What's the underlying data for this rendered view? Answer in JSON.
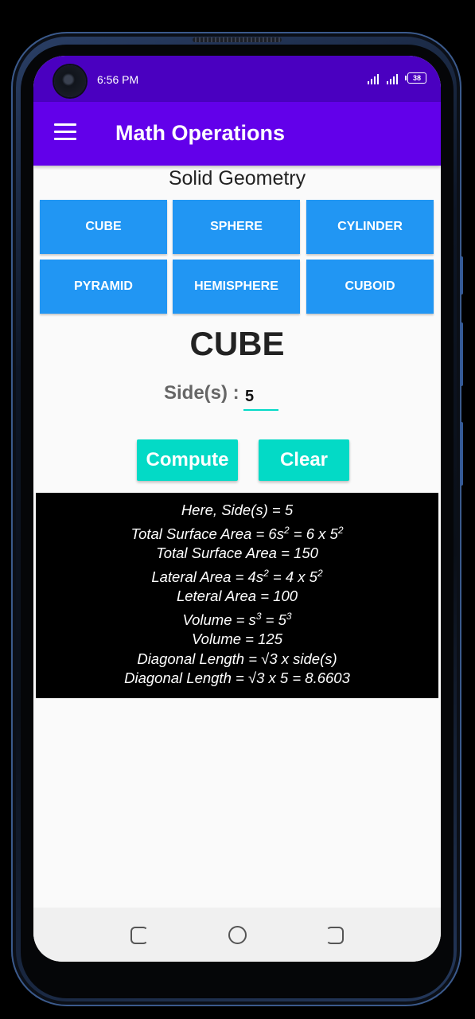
{
  "status_bar": {
    "time": "6:56 PM",
    "battery": "38"
  },
  "app_bar": {
    "title": "Math Operations"
  },
  "section_title": "Solid Geometry",
  "shapes": [
    {
      "label": "CUBE"
    },
    {
      "label": "SPHERE"
    },
    {
      "label": "CYLINDER"
    },
    {
      "label": "PYRAMID"
    },
    {
      "label": "HEMISPHERE"
    },
    {
      "label": "CUBOID"
    }
  ],
  "selected_shape": "CUBE",
  "input": {
    "label": "Side(s) :",
    "value": "5"
  },
  "buttons": {
    "compute": "Compute",
    "clear": "Clear"
  },
  "results": [
    {
      "text": "Here, Side(s) = 5"
    },
    {
      "parts": [
        "Total Surface Area = 6s",
        "2",
        " = 6 x 5",
        "2"
      ]
    },
    {
      "text": "Total Surface Area = 150"
    },
    {
      "parts": [
        "Lateral Area = 4s",
        "2",
        " = 4 x 5",
        "2"
      ]
    },
    {
      "text": "Leteral Area = 100"
    },
    {
      "parts": [
        "Volume = s",
        "3",
        " = 5",
        "3"
      ]
    },
    {
      "text": "Volume = 125"
    },
    {
      "text": "Diagonal Length = √3 x side(s)"
    },
    {
      "text": "Diagonal Length = √3 x 5 = 8.6603"
    }
  ],
  "colors": {
    "status_bar": "#4a00c0",
    "app_bar": "#6200ea",
    "shape_button": "#2196f3",
    "action_button": "#03dac6",
    "result_bg": "#000000"
  },
  "icons": {
    "menu": "hamburger-menu-icon",
    "nav_recents": "recents-icon",
    "nav_home": "home-icon",
    "nav_back": "back-icon"
  }
}
